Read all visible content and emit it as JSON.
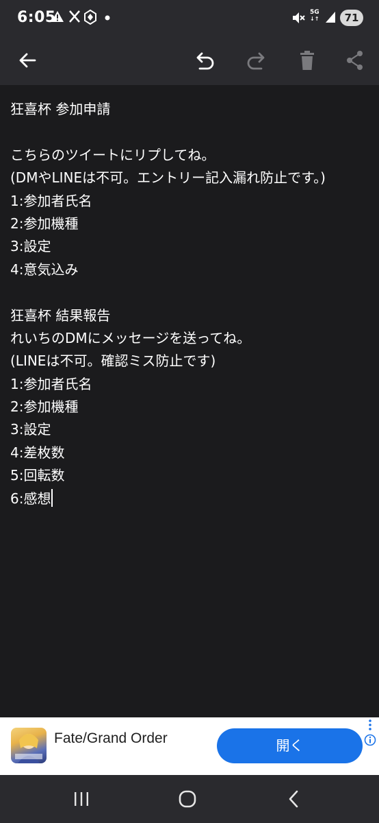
{
  "status_bar": {
    "time": "6:05",
    "network": "5G",
    "battery": "71",
    "icons": [
      "alert-icon",
      "x-logo-icon",
      "app-icon",
      "dot-icon",
      "mute-icon",
      "signal-icon"
    ]
  },
  "toolbar": {
    "icons": [
      "back-arrow-icon",
      "undo-icon",
      "redo-icon",
      "delete-icon",
      "share-icon"
    ]
  },
  "note": {
    "lines": [
      "狂喜杯 参加申請",
      "",
      "こちらのツイートにリプしてね。",
      "(DMやLINEは不可。エントリー記入漏れ防止です。)",
      "1:参加者氏名",
      "2:参加機種",
      "3:設定",
      "4:意気込み",
      "",
      "狂喜杯 結果報告",
      "れいちのDMにメッセージを送ってね。",
      "(LINEは不可。確認ミス防止です)",
      "1:参加者氏名",
      "2:参加機種",
      "3:設定",
      "4:差枚数",
      "5:回転数",
      "6:感想"
    ]
  },
  "ad": {
    "title": "Fate/Grand Order",
    "button_label": "開く",
    "accent_color": "#1a73e8"
  },
  "nav_bar": {
    "icons": [
      "recent-apps-icon",
      "home-icon",
      "back-icon"
    ]
  }
}
